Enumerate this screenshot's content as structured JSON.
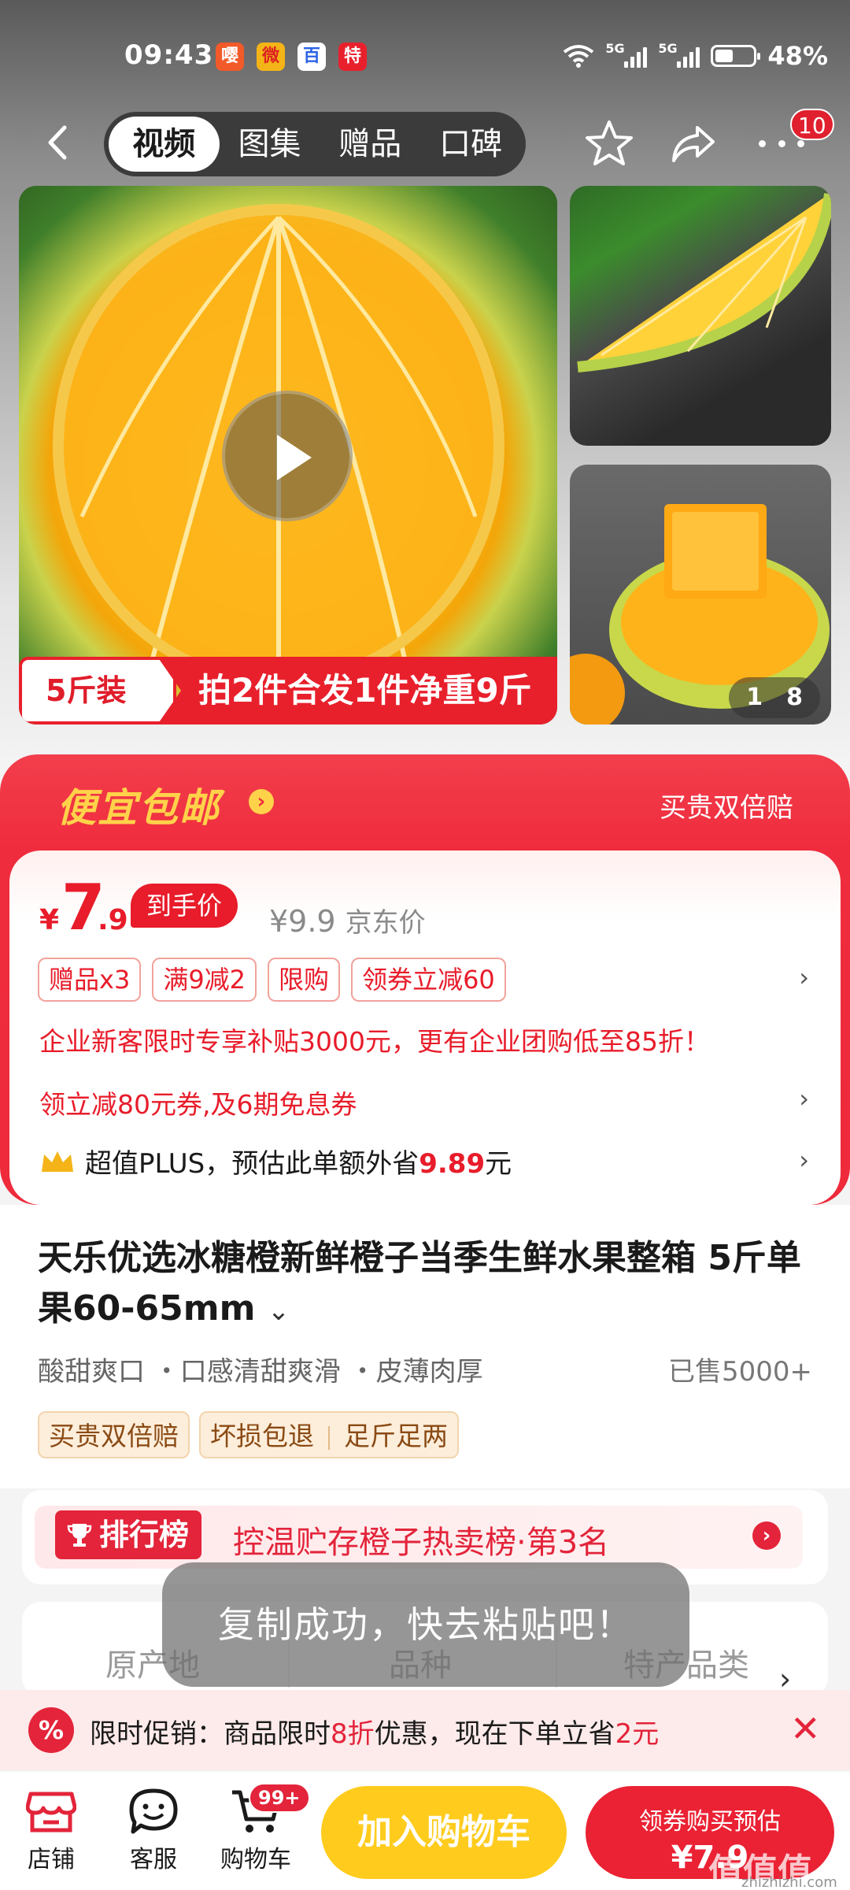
{
  "status_bar": {
    "time": "09:43",
    "notifications": [
      "嘤",
      "微",
      "百",
      "特"
    ],
    "net1": "5G",
    "net2": "5G",
    "battery": "48%",
    "battery_level": 0.48
  },
  "nav": {
    "tabs": [
      "视频",
      "图集",
      "赠品",
      "口碑"
    ],
    "active_tab": 0,
    "more_badge": "10"
  },
  "gallery": {
    "banner_left": "5斤装",
    "banner_right": "拍2件合发1件净重9斤",
    "counter_current": "1",
    "counter_total": "8"
  },
  "deal": {
    "title": "便宜包邮",
    "guarantee": "买贵双倍赔",
    "currency": "¥",
    "price_int": "7",
    "price_dec": ".9",
    "final_price_tag": "到手价",
    "jd_price": "¥9.9",
    "jd_label": "京东价",
    "chips": [
      "赠品x3",
      "满9减2",
      "限购",
      "领券立减60"
    ],
    "enterprise_line": "企业新客限时专享补贴3000元，更有企业团购低至85折！",
    "coupon_line": "领立减80元券,及6期免息券",
    "plus_text": "超值PLUS，预估此单额外省",
    "plus_amount": "9.89",
    "plus_unit": "元"
  },
  "product": {
    "title": "天乐优选冰糖橙新鲜橙子当季生鲜水果整箱 5斤单果60-65mm",
    "features": "酸甜爽口 ・口感清甜爽滑 ・皮薄肉厚",
    "sold": "已售5000+",
    "tags": [
      "买贵双倍赔",
      "坏损包退",
      "足斤足两"
    ]
  },
  "ranking": {
    "badge": "排行榜",
    "text": "控温贮存橙子热卖榜·第3名"
  },
  "specs": [
    "原产地",
    "品种",
    "特产品类"
  ],
  "toast": "复制成功，快去粘贴吧！",
  "flash": {
    "icon": "%",
    "prefix": "限时促销：商品限时",
    "discount": "8折",
    "middle": "优惠，现在下单立省",
    "save": "2元"
  },
  "bottom": {
    "shop": "店铺",
    "service": "客服",
    "cart": "购物车",
    "cart_badge": "99+",
    "add_cart": "加入购物车",
    "buy_line1": "领券购买预估",
    "buy_line2": "¥7.9"
  },
  "watermark": {
    "main": "值值值",
    "sub": "zhizhizhi.com"
  },
  "colors": {
    "brand_red": "#e81c2a",
    "deal_yellow": "#ffd24a",
    "add_cart_yellow": "#ffcc1e"
  }
}
